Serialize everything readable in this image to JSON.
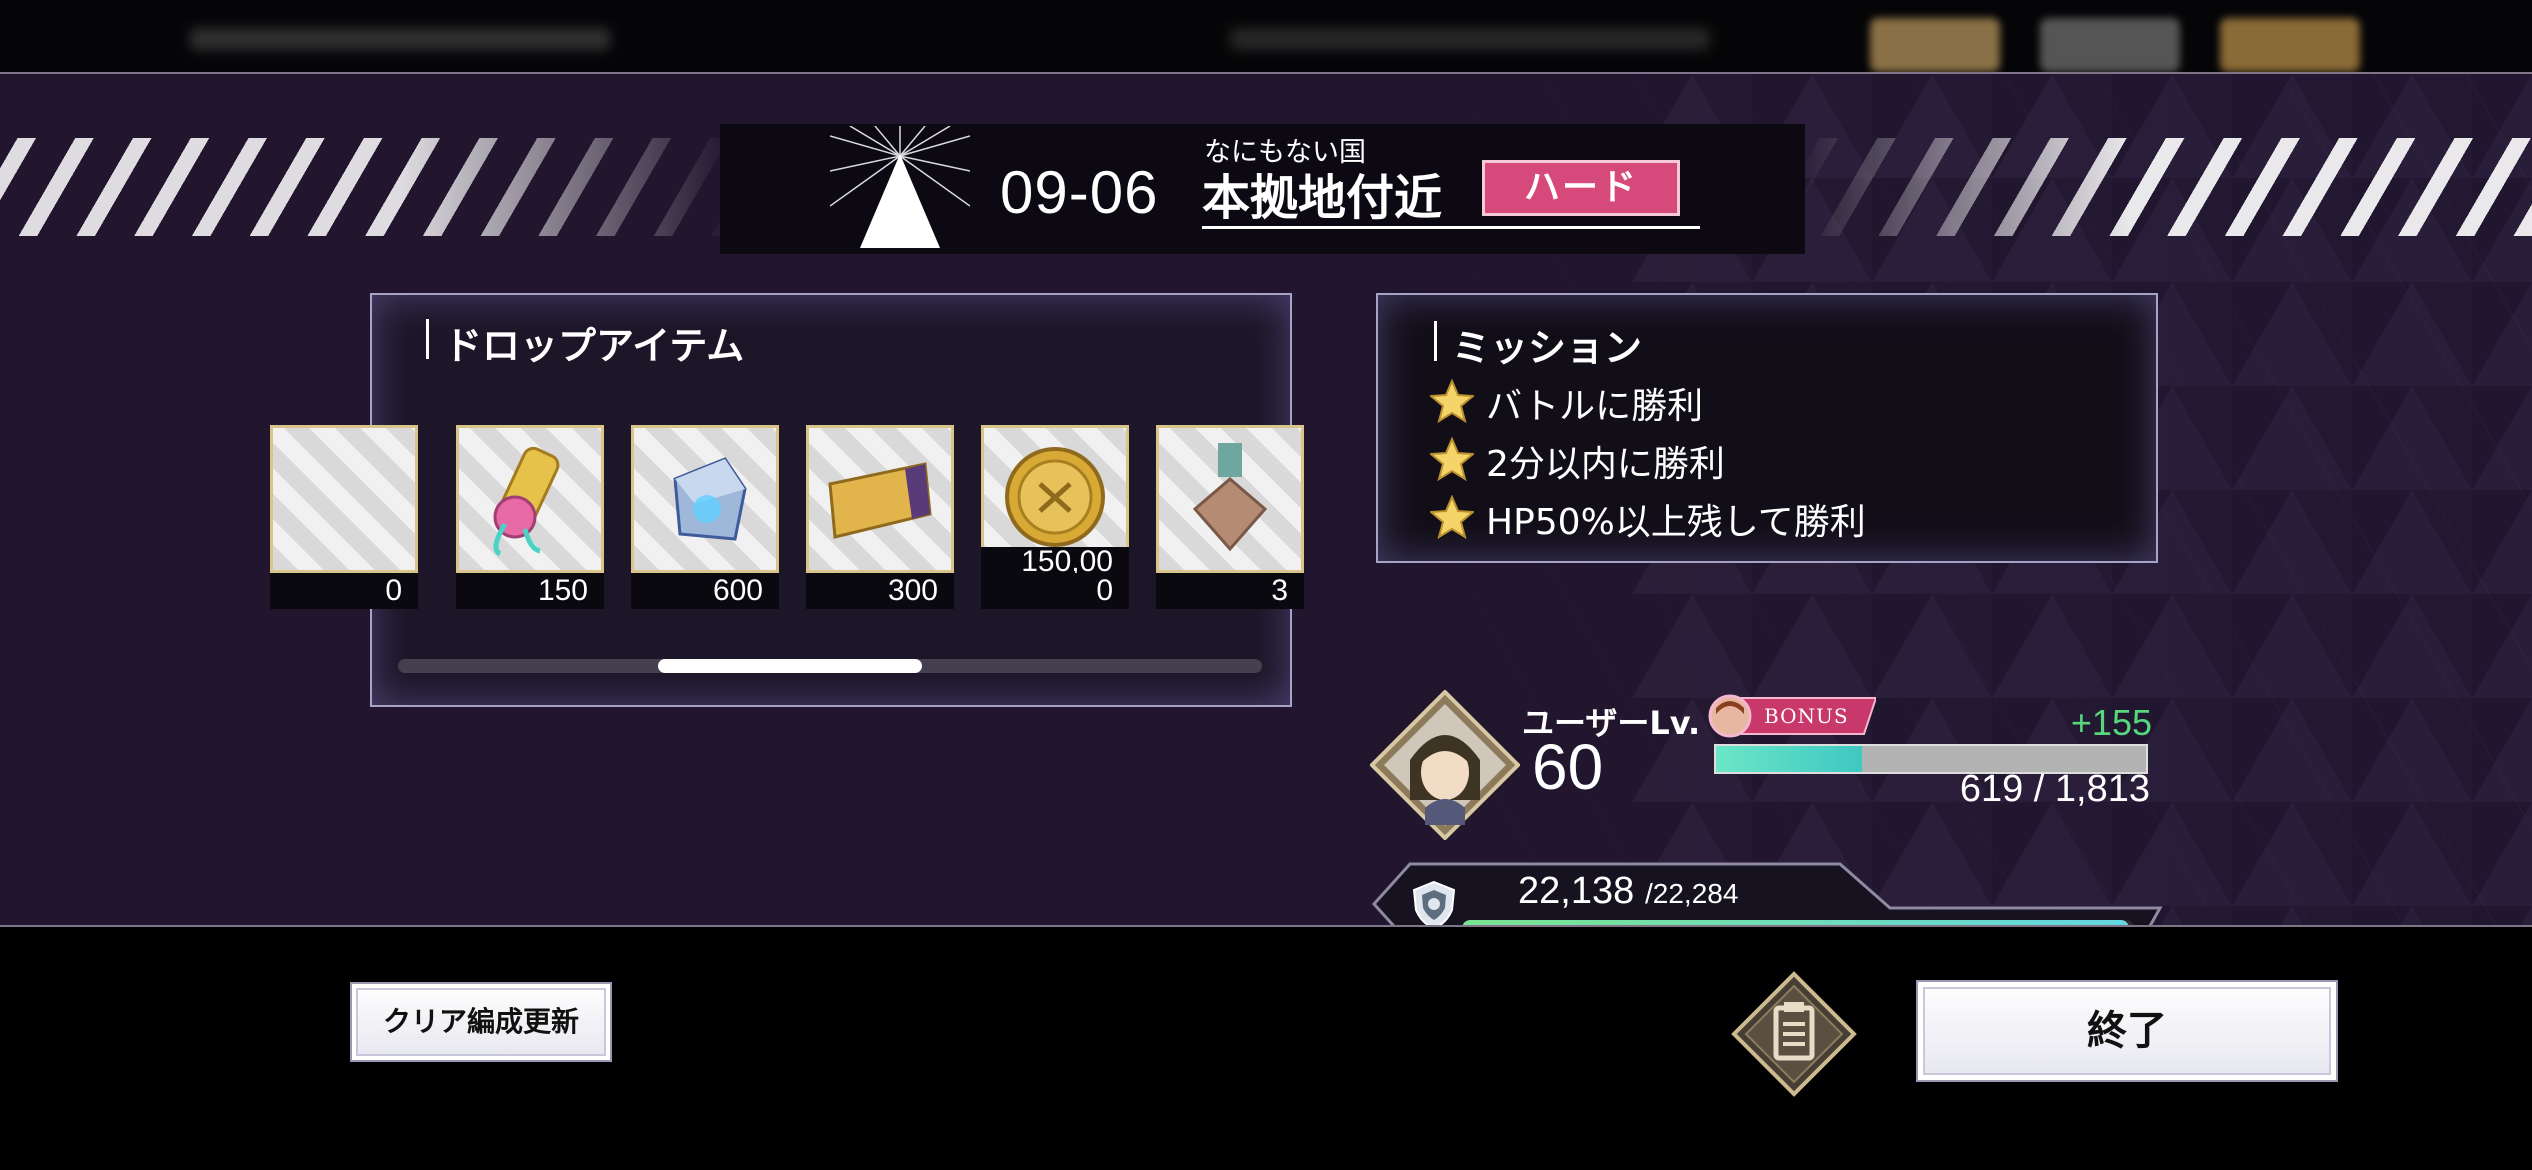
{
  "stage": {
    "code": "09-06",
    "area": "なにもない国",
    "name": "本拠地付近",
    "difficulty": "ハード"
  },
  "drops": {
    "title": "ドロップアイテム",
    "items": [
      {
        "icon": "partial-item-icon",
        "count": "0"
      },
      {
        "icon": "scroll-icon",
        "count": "150"
      },
      {
        "icon": "crystal-cube-icon",
        "count": "600"
      },
      {
        "icon": "gold-ticket-icon",
        "count": "300"
      },
      {
        "icon": "gold-coin-icon",
        "count_top": "150,00",
        "count": "0"
      },
      {
        "icon": "medal-icon",
        "count": "3"
      }
    ],
    "scroll_position": 0.33
  },
  "missions": {
    "title": "ミッション",
    "items": [
      {
        "icon": "star-icon",
        "label": "バトルに勝利"
      },
      {
        "icon": "star-icon",
        "label": "2分以内に勝利"
      },
      {
        "icon": "star-icon",
        "label": "HP50%以上残して勝利"
      }
    ]
  },
  "user": {
    "level_label": "ユーザーLv.",
    "level": "60",
    "bonus_label": "BONUS",
    "exp_gain": "+155",
    "exp_text": "619 / 1,813",
    "exp_fraction": 0.34
  },
  "power": {
    "current": "22,138",
    "max": "/22,284",
    "fraction": 0.993
  },
  "buttons": {
    "clear_update": "クリア編成更新",
    "end": "終了"
  },
  "colors": {
    "difficulty_badge": "#d64a7b",
    "exp_gain": "#56d67d",
    "exp_fill": "#6be6c7",
    "power_fill": "#64d6e0"
  }
}
